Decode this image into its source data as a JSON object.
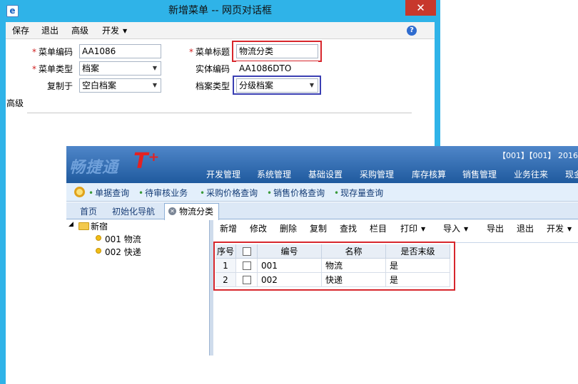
{
  "dialog": {
    "title": "新增菜单 -- 网页对话框",
    "close": "✕",
    "app_icon": "e"
  },
  "menubar": {
    "save": "保存",
    "exit": "退出",
    "advanced": "高级",
    "develop": "开发"
  },
  "form": {
    "menu_code_label": "菜单编码",
    "menu_code_value": "AA1086",
    "menu_title_label": "菜单标题",
    "menu_title_value": "物流分类",
    "menu_type_label": "菜单类型",
    "menu_type_value": "档案",
    "entity_code_label": "实体编码",
    "entity_code_value": "AA1086DTO",
    "copy_from_label": "复制于",
    "copy_from_value": "空白档案",
    "archive_type_label": "档案类型",
    "archive_type_value": "分级档案",
    "required_mark": "*",
    "advanced_section": "高级"
  },
  "app": {
    "logo_text": "畅捷通",
    "logo_t": "T⁺",
    "account": "【001】【001】 2016",
    "topnav": [
      "开发管理",
      "系统管理",
      "基础设置",
      "采购管理",
      "库存核算",
      "销售管理",
      "业务往来",
      "现金"
    ],
    "quicklinks": [
      "单据查询",
      "待审核业务",
      "采购价格查询",
      "销售价格查询",
      "现存量查询"
    ],
    "tabs": {
      "home": "首页",
      "init_nav": "初始化导航",
      "logistics": "物流分类"
    },
    "tree": {
      "root": "新宿",
      "items": [
        "001 物流",
        "002 快递"
      ]
    },
    "toolbar": [
      "新增",
      "修改",
      "删除",
      "复制",
      "查找",
      "栏目",
      "打印",
      "导入",
      "导出",
      "退出",
      "开发"
    ],
    "grid": {
      "headers": {
        "seq": "序号",
        "code": "编号",
        "name": "名称",
        "is_last": "是否末级"
      },
      "rows": [
        {
          "seq": "1",
          "code": "001",
          "name": "物流",
          "is_last": "是"
        },
        {
          "seq": "2",
          "code": "002",
          "name": "快递",
          "is_last": "是"
        }
      ]
    }
  },
  "colors": {
    "dialog_frame": "#2fb3e8",
    "close_button": "#c7382c",
    "highlight_red": "#d7262c",
    "highlight_blue": "#3a3fb3",
    "app_header": "#2e6db4"
  }
}
